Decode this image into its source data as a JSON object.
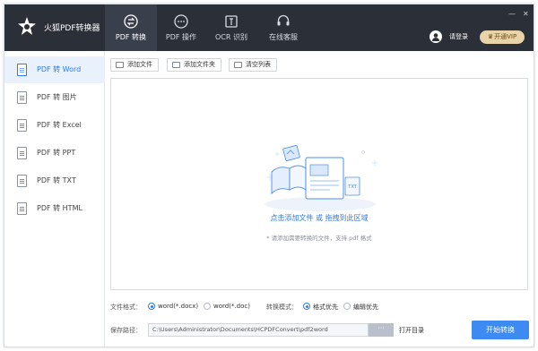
{
  "app": {
    "title": "火狐PDF转换器"
  },
  "nav_tabs": [
    {
      "label": "PDF 转换",
      "icon": "convert-icon",
      "active": true
    },
    {
      "label": "PDF 操作",
      "icon": "chat-bubble-icon",
      "active": false
    },
    {
      "label": "OCR 识别",
      "icon": "scan-icon",
      "active": false
    },
    {
      "label": "在线客服",
      "icon": "headset-icon",
      "active": false
    }
  ],
  "window_controls": {
    "minimize": "—",
    "close": "✕"
  },
  "user": {
    "login_label": "请登录",
    "vip_label": "开通VIP",
    "vip_color": "#e9d3a8"
  },
  "sidebar": {
    "items": [
      {
        "label": "PDF 转 Word",
        "active": true
      },
      {
        "label": "PDF 转 图片",
        "active": false
      },
      {
        "label": "PDF 转 Excel",
        "active": false
      },
      {
        "label": "PDF 转 PPT",
        "active": false
      },
      {
        "label": "PDF 转 TXT",
        "active": false
      },
      {
        "label": "PDF 转 HTML",
        "active": false
      }
    ]
  },
  "toolbar": {
    "add_file": "添加文件",
    "add_folder": "添加文件夹",
    "clear_list": "清空列表"
  },
  "drop_area": {
    "main_text": "点击添加文件 或 拖拽到此区域",
    "hint_text": "* 请添加需要转换的文件，支持 pdf 格式"
  },
  "options": {
    "format_label": "文件格式：",
    "format_choices": [
      {
        "label": "word(*.docx)",
        "selected": true
      },
      {
        "label": "word(*.doc)",
        "selected": false
      }
    ],
    "mode_label": "转换模式：",
    "mode_choices": [
      {
        "label": "格式优先",
        "selected": true
      },
      {
        "label": "编辑优先",
        "selected": false
      }
    ],
    "save_label": "保存路径：",
    "save_path": "C:\\Users\\Administrator\\Documents\\HCPDFConvert\\pdf2word",
    "browse_label": "···",
    "open_dir_label": "打开目录",
    "start_label": "开始转换"
  },
  "colors": {
    "accent": "#3d8bf2",
    "topbar": "#2b2f38",
    "sidebar_active": "#e8f1fc"
  }
}
